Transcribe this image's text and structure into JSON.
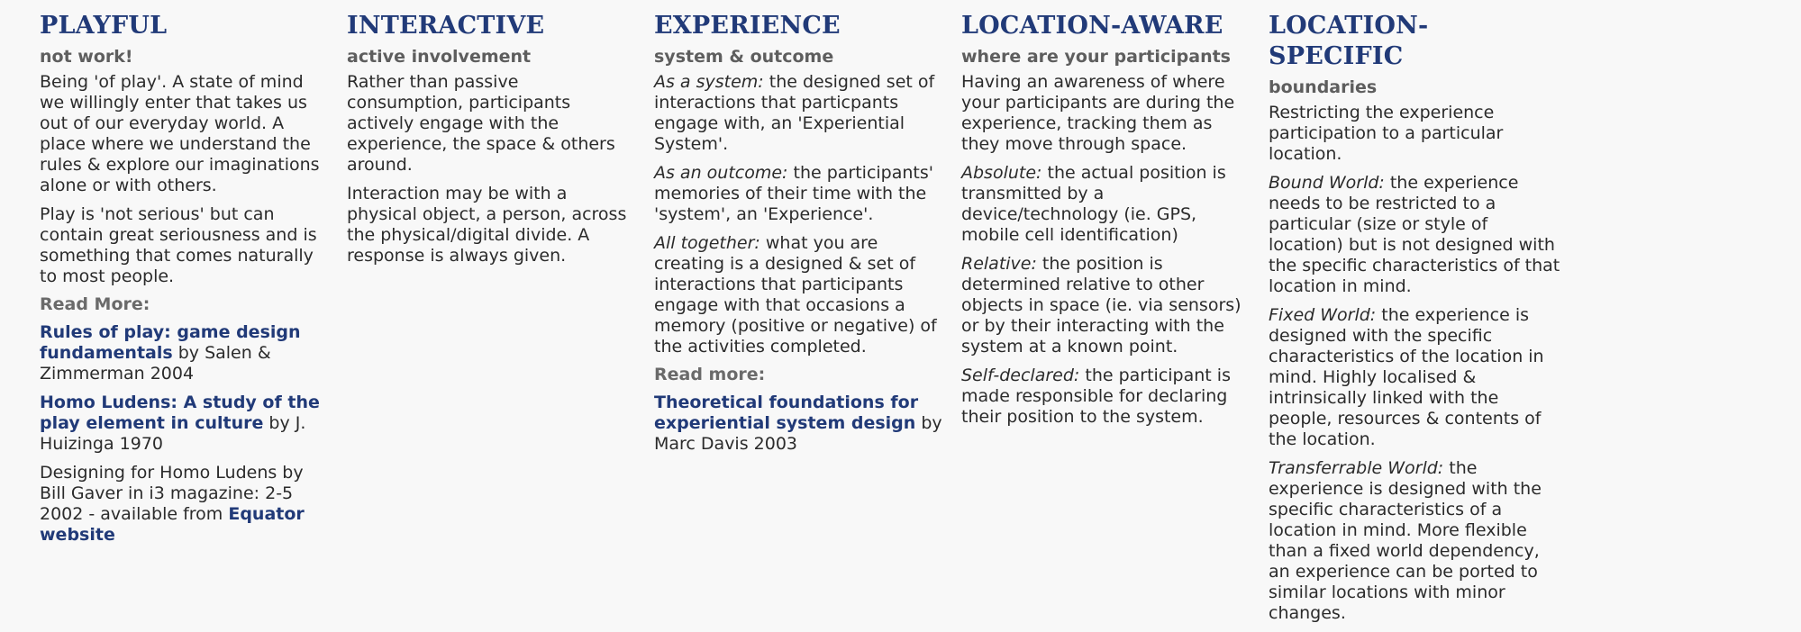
{
  "columns": [
    {
      "title": "PLAYFUL",
      "subtitle": "not work!",
      "paragraphs": [
        "Being 'of play'. A state of mind we willingly enter that takes us out of our everyday world. A place where we understand the rules & explore our imaginations alone or with others.",
        "Play is 'not serious' but can contain great seriousness and is something that comes naturally to most people."
      ],
      "read_more_label": "Read More:",
      "refs": [
        {
          "link": "Rules of play: game design fundamentals",
          "text": " by Salen & Zimmerman 2004"
        },
        {
          "link": "Homo Ludens: A study of the play element in culture",
          "text": " by J. Huizinga 1970"
        }
      ],
      "final_ref": {
        "text": "Designing for Homo Ludens by Bill Gaver in i3 magazine: 2-5 2002 - available from ",
        "link": "Equator website"
      }
    },
    {
      "title": "INTERACTIVE",
      "subtitle": "active involvement",
      "paragraphs": [
        "Rather than passive consumption, participants actively engage with the experience, the space & others around.",
        "Interaction may be with a physical object, a person, across the physical/digital divide. A response is always given."
      ]
    },
    {
      "title": "EXPERIENCE",
      "subtitle": "system & outcome",
      "items": [
        {
          "term": "As a system:",
          "text": " the designed set of interactions that particpants engage with, an 'Experiential System'."
        },
        {
          "term": "As an outcome:",
          "text": " the participants' memories of their time with the 'system', an 'Experience'."
        },
        {
          "term": "All together:",
          "text": " what you are creating is a designed & set of interactions that participants engage with that occasions a memory (positive or negative) of the activities completed."
        }
      ],
      "read_more_label": "Read more:",
      "refs": [
        {
          "link": "Theoretical foundations for experiential system design",
          "text": " by Marc Davis 2003"
        }
      ]
    },
    {
      "title": "LOCATION-AWARE",
      "subtitle": "where are your participants",
      "intro": "Having an awareness of where your participants are during the experience, tracking them as they move through space.",
      "items": [
        {
          "term": "Absolute:",
          "text": " the actual position is transmitted by a device/technology (ie. GPS, mobile cell identification)"
        },
        {
          "term": "Relative:",
          "text": " the position is determined relative to other objects in space (ie. via sensors) or by their interacting with the system at a known point."
        },
        {
          "term": "Self-declared:",
          "text": " the participant is made responsible for declaring their position to the system."
        }
      ]
    },
    {
      "title": "LOCATION-SPECIFIC",
      "subtitle": "boundaries",
      "intro": "Restricting the experience participation to a particular location.",
      "items": [
        {
          "term": "Bound World:",
          "text": " the experience needs to be restricted to a particular (size or style of location) but is not designed with the specific characteristics of that location in mind."
        },
        {
          "term": "Fixed World:",
          "text": " the experience is designed with the specific characteristics of the location in mind. Highly localised & intrinsically linked with the people, resources & contents of the location."
        },
        {
          "term": "Transferrable World:",
          "text": " the experience is designed with the specific characteristics of a location in mind. More flexible than a fixed world dependency, an experience can be ported to similar locations with minor changes."
        }
      ]
    }
  ],
  "colors": {
    "background": "#f8f8f8",
    "title": "#213a78",
    "subtitle": "#5e5e5e",
    "body": "#2b2b2b",
    "link": "#213a78"
  }
}
